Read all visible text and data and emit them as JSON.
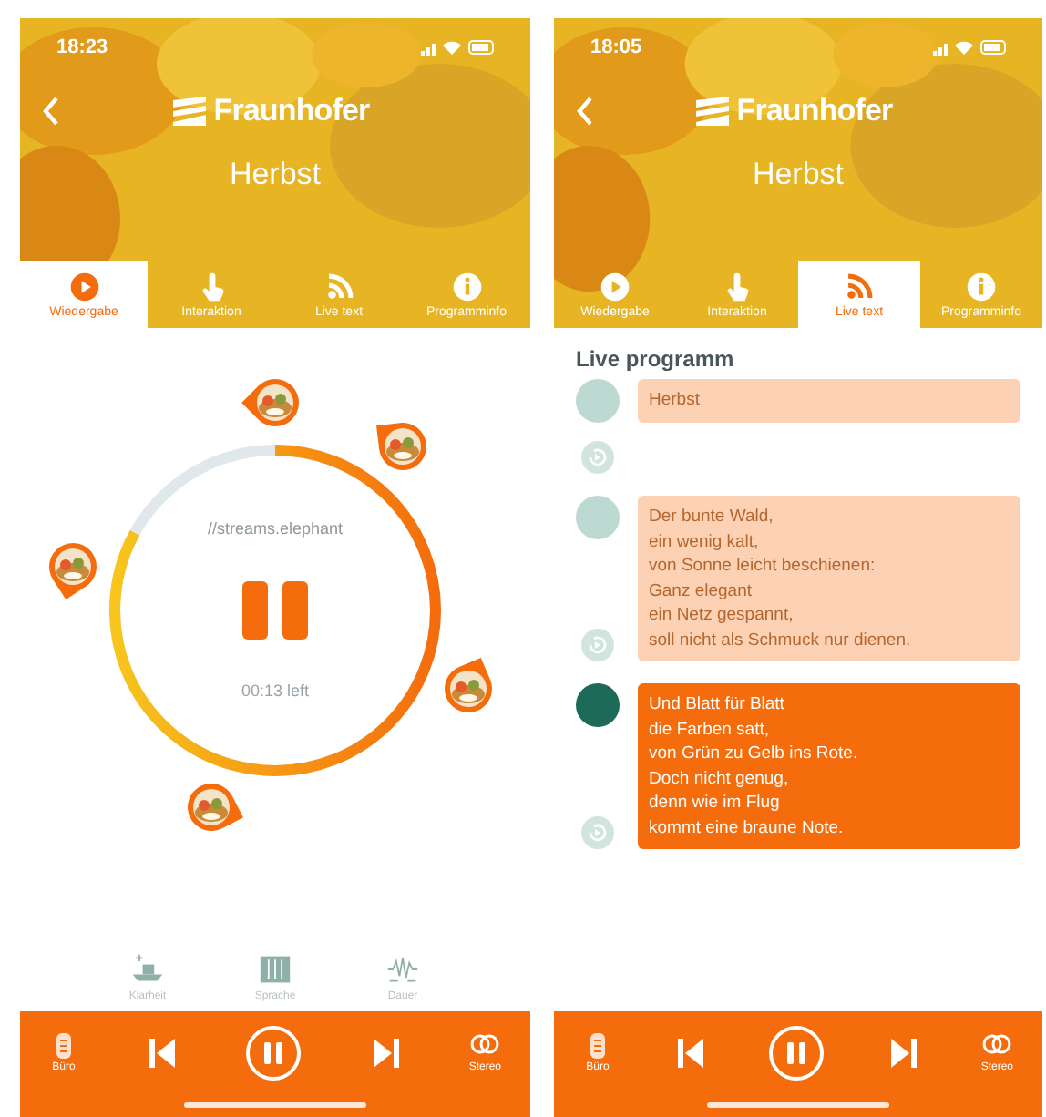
{
  "screens": [
    {
      "kind": "player",
      "status_time": "18:23",
      "brand": "Fraunhofer",
      "title": "Herbst",
      "tabs": [
        {
          "label": "Wiedergabe",
          "selected": true
        },
        {
          "label": "Interaktion",
          "selected": false
        },
        {
          "label": "Live text",
          "selected": false
        },
        {
          "label": "Programminfo",
          "selected": false
        }
      ],
      "player": {
        "stream": "//streams.elephant",
        "level": 0.83,
        "remaining": "00:13 left",
        "playing": true
      },
      "modes": [
        {
          "label": "Klarheit"
        },
        {
          "label": "Sprache"
        },
        {
          "label": "Dauer"
        }
      ],
      "controls": {
        "left": "Büro",
        "right": "Stereo",
        "playing": true
      }
    },
    {
      "kind": "live",
      "status_time": "18:05",
      "brand": "Fraunhofer",
      "title": "Herbst",
      "tabs": [
        {
          "label": "Wiedergabe",
          "selected": false
        },
        {
          "label": "Interaktion",
          "selected": false
        },
        {
          "label": "Live text",
          "selected": true
        },
        {
          "label": "Programminfo",
          "selected": false
        }
      ],
      "heading": "Live programm",
      "entries": [
        {
          "text": "Herbst",
          "current": false
        },
        {
          "text": "Der bunte Wald,\nein wenig kalt,\nvon Sonne leicht beschienen:\nGanz elegant\nein Netz gespannt,\nsoll nicht als Schmuck nur dienen.",
          "current": false
        },
        {
          "text": "Und Blatt für Blatt\ndie Farben satt,\nvon Grün zu Gelb ins Rote.\nDoch nicht genug,\ndenn wie im Flug\nkommt eine braune Note.",
          "current": true
        }
      ],
      "controls": {
        "left": "Büro",
        "right": "Stereo",
        "playing": true
      }
    }
  ]
}
